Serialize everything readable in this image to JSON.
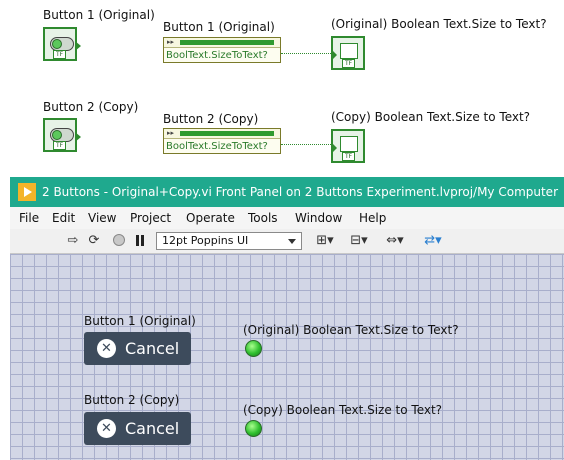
{
  "block_diagram": {
    "button1_label": "Button 1 (Original)",
    "button2_label": "Button 2 (Copy)",
    "prop_node1_label": "Button 1 (Original)",
    "prop_node2_label": "Button 2 (Copy)",
    "prop_name": "BoolText.SizeToText?",
    "indicator1_label": "(Original) Boolean Text.Size to Text?",
    "indicator2_label": "(Copy) Boolean Text.Size to Text?",
    "tf_text": "TF"
  },
  "window": {
    "title": "2 Buttons - Original+Copy.vi Front Panel on 2 Buttons Experiment.lvproj/My Computer",
    "menu": [
      "File",
      "Edit",
      "View",
      "Project",
      "Operate",
      "Tools",
      "Window",
      "Help"
    ],
    "toolbar": {
      "font_value": "12pt Poppins UI",
      "icons": [
        "run-arrow-icon",
        "run-continuously-icon",
        "abort-icon",
        "pause-icon",
        "align-icon",
        "distribute-icon",
        "resize-icon",
        "reorder-icon"
      ]
    }
  },
  "front_panel": {
    "button1_label": "Button 1 (Original)",
    "button2_label": "Button 2 (Copy)",
    "button_text": "Cancel",
    "indicator1_label": "(Original) Boolean Text.Size to Text?",
    "indicator2_label": "(Copy) Boolean Text.Size to Text?"
  },
  "colors": {
    "titlebar": "#1fa98e",
    "button_bg": "#3d4b5c",
    "led_on": "#2fbf2f",
    "grid_bg": "#d2d6e6"
  }
}
